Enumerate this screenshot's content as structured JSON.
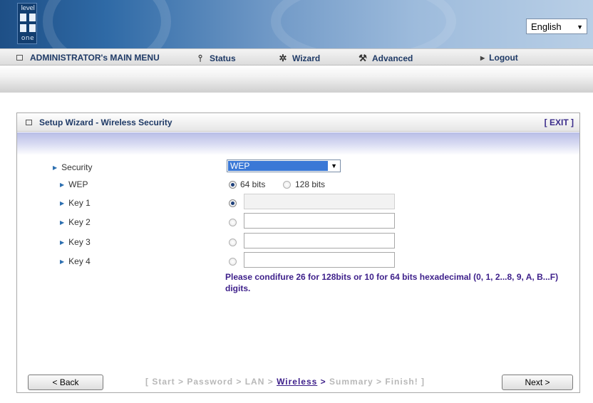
{
  "banner": {
    "logo_top": "level",
    "logo_bottom": "one",
    "language": "English"
  },
  "menu": {
    "main_menu": "ADMINISTRATOR's MAIN MENU",
    "status": "Status",
    "wizard": "Wizard",
    "advanced": "Advanced",
    "logout": "Logout",
    "icons": {
      "status": "status-icon",
      "wizard": "wizard-icon",
      "advanced": "advanced-icon",
      "logout": "arrow-right-icon"
    }
  },
  "panel": {
    "title": "Setup Wizard - Wireless Security",
    "exit": "[ EXIT ]"
  },
  "form": {
    "security_label": "Security",
    "security_value": "WEP",
    "wep_label": "WEP",
    "wep_option_64": "64 bits",
    "wep_option_128": "128 bits",
    "wep_selected": "64 bits",
    "key_labels": [
      "Key 1",
      "Key 2",
      "Key 3",
      "Key 4"
    ],
    "key_values": [
      "",
      "",
      "",
      ""
    ],
    "selected_key": "Key 1",
    "hint": "Please condifure 26 for 128bits or 10 for 64 bits hexadecimal (0, 1, 2...8, 9, A, B...F) digits."
  },
  "footer": {
    "back": "< Back",
    "next": "Next >",
    "steps_prefix": "[ Start > Password > LAN > ",
    "steps_current": "Wireless",
    "steps_arrow": " > ",
    "steps_suffix": "Summary > Finish! ]"
  },
  "colors": {
    "banner_dark": "#1e4f86",
    "menu_text": "#1f3a66",
    "accent_purple": "#3d1f8a",
    "bullet_blue": "#2c6fb0"
  }
}
